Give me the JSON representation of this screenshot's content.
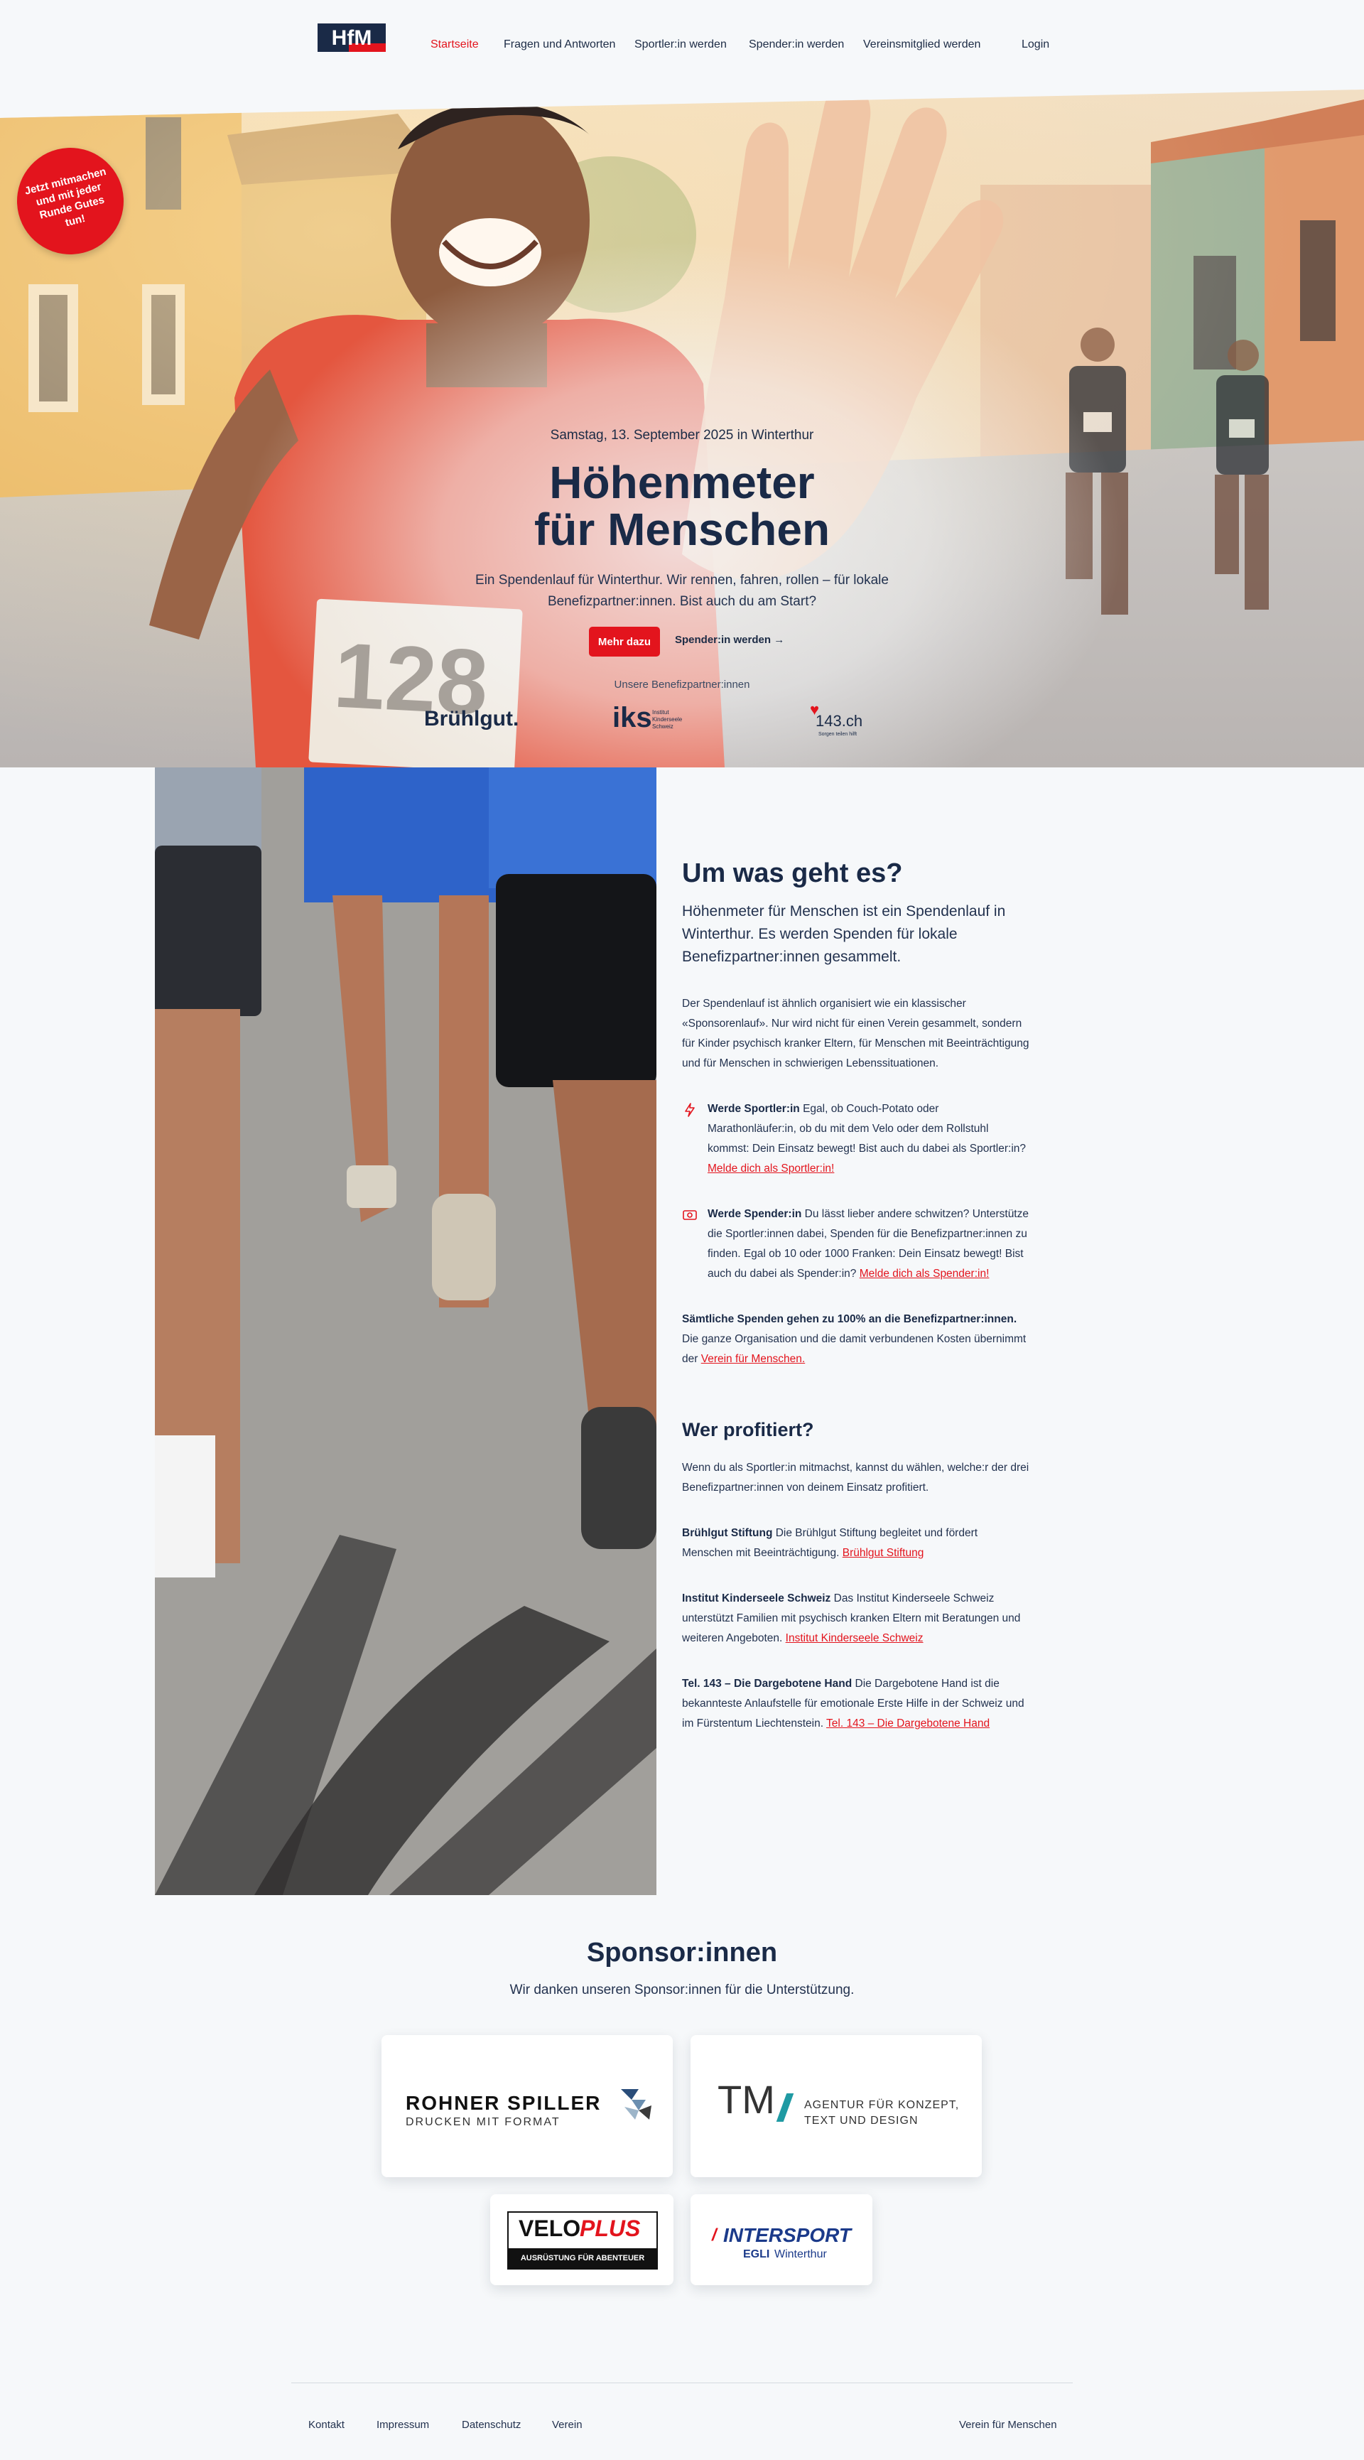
{
  "nav": {
    "logo_text": "HfM",
    "items": [
      {
        "label": "Startseite",
        "active": true
      },
      {
        "label": "Fragen und Antworten"
      },
      {
        "label": "Sportler:in werden"
      },
      {
        "label": "Spender:in werden"
      },
      {
        "label": "Vereinsmitglied werden"
      }
    ],
    "login": "Login"
  },
  "sticker": "Jetzt mitmachen und mit jeder Runde Gutes tun!",
  "hero": {
    "date": "Samstag, 13. September 2025 in Winterthur",
    "title_line1": "Höhenmeter",
    "title_line2": "für Menschen",
    "lead": "Ein Spendenlauf für Winterthur. Wir rennen, fahren, rollen – für lokale Benefizpartner:innen. Bist auch du am Start?",
    "cta_primary": "Mehr dazu",
    "cta_secondary": "Spender:in werden →",
    "bib_number": "128",
    "partners_label": "Unsere Benefizpartner:innen",
    "partners": {
      "bruehlgut": "Brühlgut.",
      "iks_mark": "iks",
      "iks_text": "Institut Kinderseele Schweiz",
      "tel143": "143.ch",
      "tel143_sub": "Sorgen teilen hilft"
    }
  },
  "about": {
    "title": "Um was geht es?",
    "lead": "Höhenmeter für Menschen ist ein Spendenlauf in Winterthur. Es werden Spenden für lokale Benefizpartner:innen gesammelt.",
    "intro": "Der Spendenlauf ist ähnlich organisiert wie ein klassischer «Sponsorenlauf». Nur wird nicht für einen Verein gesammelt, sondern für Kinder psychisch kranker Eltern, für Menschen mit Beeinträchtigung und für Menschen in schwierigen Lebenssituationen.",
    "athlete": {
      "title": "Werde Sportler:in",
      "text": " Egal, ob Couch-Potato oder Marathonläufer:in, ob du mit dem Velo oder dem Rollstuhl kommst: Dein Einsatz bewegt! Bist auch du dabei als Sportler:in? ",
      "link": "Melde dich als Sportler:in!"
    },
    "donor": {
      "title": "Werde Spender:in",
      "text": " Du lässt lieber andere schwitzen? Unterstütze die Sportler:innen dabei, Spenden für die Benefizpartner:innen zu finden. Egal ob 10 oder 1000 Franken: Dein Einsatz bewegt! Bist auch du dabei als Spender:in? ",
      "link": "Melde dich als Spender:in!"
    },
    "all_donations_bold": "Sämtliche Spenden gehen zu 100% an die Benefizpartner:innen.",
    "all_donations_text": " Die ganze Organisation und die damit verbundenen Kosten übernimmt der ",
    "all_donations_link": "Verein für Menschen."
  },
  "beneficiaries": {
    "title": "Wer profitiert?",
    "intro": "Wenn du als Sportler:in mitmachst, kannst du wählen, welche:r der drei Benefizpartner:innen von deinem Einsatz profitiert.",
    "items": [
      {
        "name": "Brühlgut Stiftung",
        "text": " Die Brühlgut Stiftung begleitet und fördert Menschen mit Beeinträchtigung. ",
        "link": "Brühlgut Stiftung"
      },
      {
        "name": "Institut Kinderseele Schweiz",
        "text": " Das Institut Kinderseele Schweiz unterstützt Familien mit psychisch kranken Eltern mit Beratungen und weiteren Angeboten. ",
        "link": "Institut Kinderseele Schweiz"
      },
      {
        "name": "Tel. 143 – Die Dargebotene Hand",
        "text": " Die Dargebotene Hand ist die bekannteste Anlaufstelle für emotionale Erste Hilfe in der Schweiz und im Fürstentum Liechtenstein. ",
        "link": "Tel. 143 – Die Dargebotene Hand"
      }
    ]
  },
  "sponsors": {
    "title": "Sponsor:innen",
    "subtitle": "Wir danken unseren Sponsor:innen für die Unterstützung.",
    "rohner_name": "ROHNER SPILLER",
    "rohner_sub": "DRUCKEN MIT FORMAT",
    "tm_mark": "TM",
    "tm_line1": "AGENTUR FÜR KONZEPT,",
    "tm_line2": "TEXT UND DESIGN",
    "velo_a": "VELO",
    "velo_b": "PLUS",
    "velo_sub": "AUSRÜSTUNG FÜR ABENTEUER",
    "intersport": "INTERSPORT",
    "intersport_egli": "EGLI",
    "intersport_city": "Winterthur"
  },
  "footer": {
    "links": [
      "Kontakt",
      "Impressum",
      "Datenschutz",
      "Verein"
    ],
    "right": "Verein für Menschen"
  },
  "colors": {
    "accent": "#e3141d",
    "navy": "#1a2a47",
    "background": "#f6f8fa"
  }
}
